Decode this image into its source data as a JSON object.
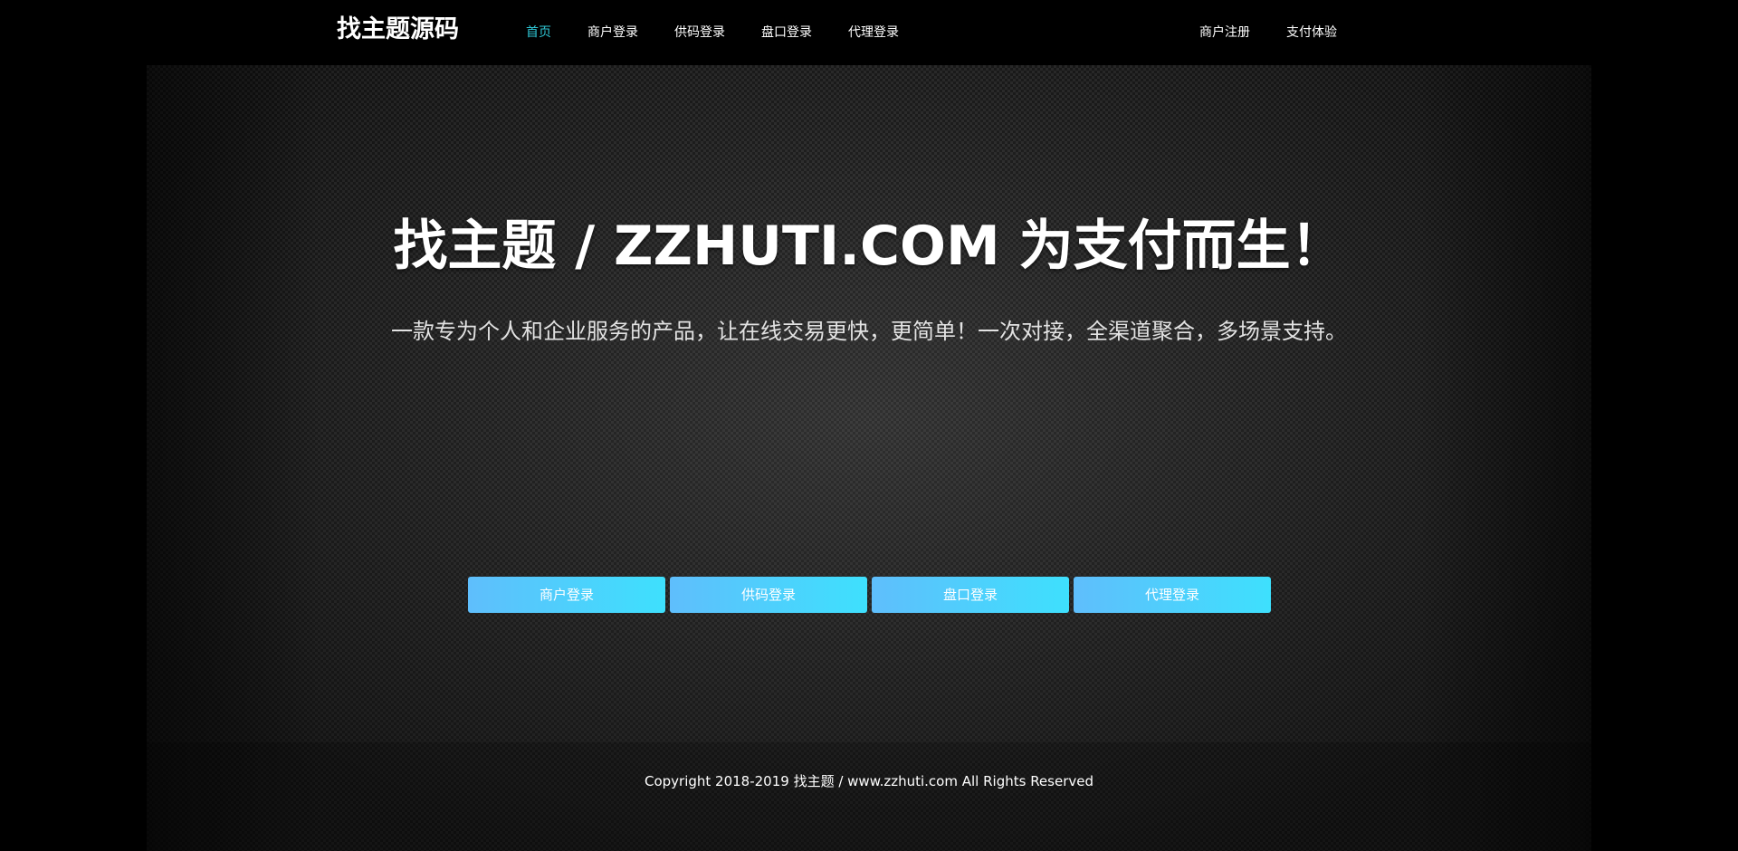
{
  "header": {
    "brand": "找主题源码",
    "nav_left": [
      {
        "label": "首页",
        "active": true
      },
      {
        "label": "商户登录",
        "active": false
      },
      {
        "label": "供码登录",
        "active": false
      },
      {
        "label": "盘口登录",
        "active": false
      },
      {
        "label": "代理登录",
        "active": false
      }
    ],
    "nav_right": [
      {
        "label": "商户注册"
      },
      {
        "label": "支付体验"
      }
    ]
  },
  "hero": {
    "title": "找主题 / ZZHUTI.COM 为支付而生！",
    "subtitle": "一款专为个人和企业服务的产品，让在线交易更快，更简单！一次对接，全渠道聚合，多场景支持。",
    "buttons": [
      {
        "label": "商户登录"
      },
      {
        "label": "供码登录"
      },
      {
        "label": "盘口登录"
      },
      {
        "label": "代理登录"
      }
    ]
  },
  "footer": {
    "copyright": "Copyright 2018-2019 找主题 / www.zzhuti.com All Rights Reserved"
  },
  "colors": {
    "active_nav": "#2fc7d6",
    "button_gradient_start": "#5fbefc",
    "button_gradient_end": "#3ee0fd",
    "background": "#000000"
  }
}
